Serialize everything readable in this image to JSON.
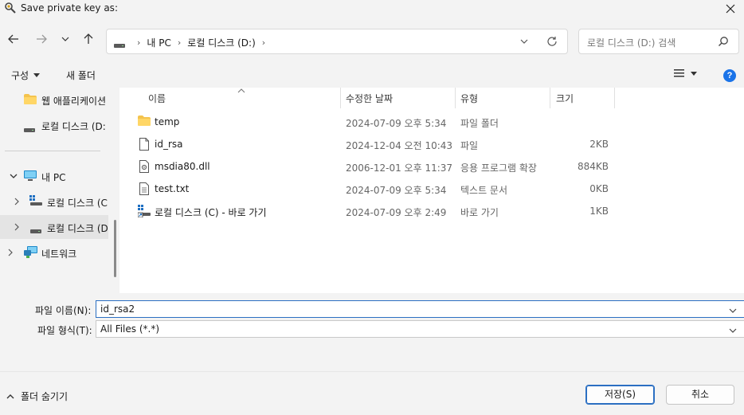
{
  "window": {
    "title": "Save private key as:"
  },
  "address_bar": {
    "crumbs": [
      "내 PC",
      "로컬 디스크 (D:)"
    ]
  },
  "search": {
    "placeholder": "로컬 디스크 (D:) 검색"
  },
  "toolbar": {
    "organize_label": "구성",
    "new_folder_label": "새 폴더"
  },
  "sidebar": {
    "items": [
      {
        "label": "웹 애플리케이션"
      },
      {
        "label": "로컬 디스크 (D:"
      },
      {
        "label": "내 PC"
      },
      {
        "label": "로컬 디스크 (C"
      },
      {
        "label": "로컬 디스크 (D"
      },
      {
        "label": "네트워크"
      }
    ]
  },
  "columns": {
    "name": "이름",
    "date": "수정한 날짜",
    "type": "유형",
    "size": "크기"
  },
  "files": [
    {
      "icon": "folder-icon",
      "name": "temp",
      "date": "2024-07-09 오후 5:34",
      "type": "파일 폴더",
      "size": ""
    },
    {
      "icon": "file-icon",
      "name": "id_rsa",
      "date": "2024-12-04 오전 10:43",
      "type": "파일",
      "size": "2KB"
    },
    {
      "icon": "dll-icon",
      "name": "msdia80.dll",
      "date": "2006-12-01 오후 11:37",
      "type": "응용 프로그램 확장",
      "size": "884KB"
    },
    {
      "icon": "text-file-icon",
      "name": "test.txt",
      "date": "2024-07-09 오후 5:34",
      "type": "텍스트 문서",
      "size": "0KB"
    },
    {
      "icon": "shortcut-icon",
      "name": "로컬 디스크 (C) - 바로 가기",
      "date": "2024-07-09 오후 2:49",
      "type": "바로 가기",
      "size": "1KB"
    }
  ],
  "filename": {
    "label": "파일 이름(N):",
    "value": "id_rsa2"
  },
  "filetype": {
    "label": "파일 형식(T):",
    "value": "All Files (*.*)"
  },
  "footer": {
    "hide_folders_label": "폴더 숨기기",
    "save_label": "저장(S)",
    "cancel_label": "취소"
  },
  "colors": {
    "accent": "#2b6fc2",
    "folder": "#f4c34d",
    "help": "#1a73e8"
  }
}
